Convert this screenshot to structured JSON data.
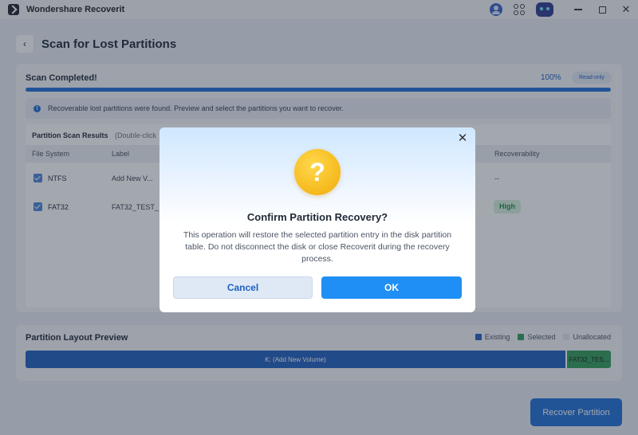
{
  "app": {
    "title": "Wondershare Recoverit"
  },
  "header": {
    "back_icon": "chevron-left-icon",
    "title": "Scan for Lost Partitions"
  },
  "scan": {
    "status": "Scan Completed!",
    "progress_label": "100%",
    "progress_value": 100,
    "badge": "Read-only",
    "info_icon": "info-icon",
    "info_text": "Recoverable lost partitions were found. Preview and select the partitions you want to recover."
  },
  "results": {
    "title": "Partition Scan Results",
    "hint": "(Double-click",
    "columns": {
      "file_system": "File System",
      "label": "Label",
      "recoverability": "Recoverability"
    },
    "rows": [
      {
        "checked": true,
        "file_system": "NTFS",
        "label": "Add New V...",
        "recoverability": "--"
      },
      {
        "checked": true,
        "file_system": "FAT32",
        "label": "FAT32_TEST_",
        "recoverability": "High"
      }
    ]
  },
  "preview": {
    "title": "Partition Layout Preview",
    "legend": {
      "existing": "Existing",
      "selected": "Selected",
      "unallocated": "Unallocated"
    },
    "colors": {
      "existing": "#1f5fbf",
      "selected": "#2f9e5a",
      "unallocated": "#e2e6ea"
    },
    "bar_main": "K: (Add New Volume)",
    "bar_selected": "FAT32_TES..."
  },
  "footer": {
    "recover_button": "Recover Partition"
  },
  "dialog": {
    "close_icon": "close-icon",
    "icon": "question-mark-icon",
    "title": "Confirm Partition Recovery?",
    "message": "This operation will restore the selected partition entry in the disk partition table. Do not disconnect the disk or close Recoverit during the recovery process.",
    "cancel_label": "Cancel",
    "ok_label": "OK"
  },
  "colors": {
    "accent": "#1f6fd8",
    "ok_button": "#1f8ff5",
    "high_badge": "#1c8c46",
    "warning_icon": "#f5b91c"
  }
}
